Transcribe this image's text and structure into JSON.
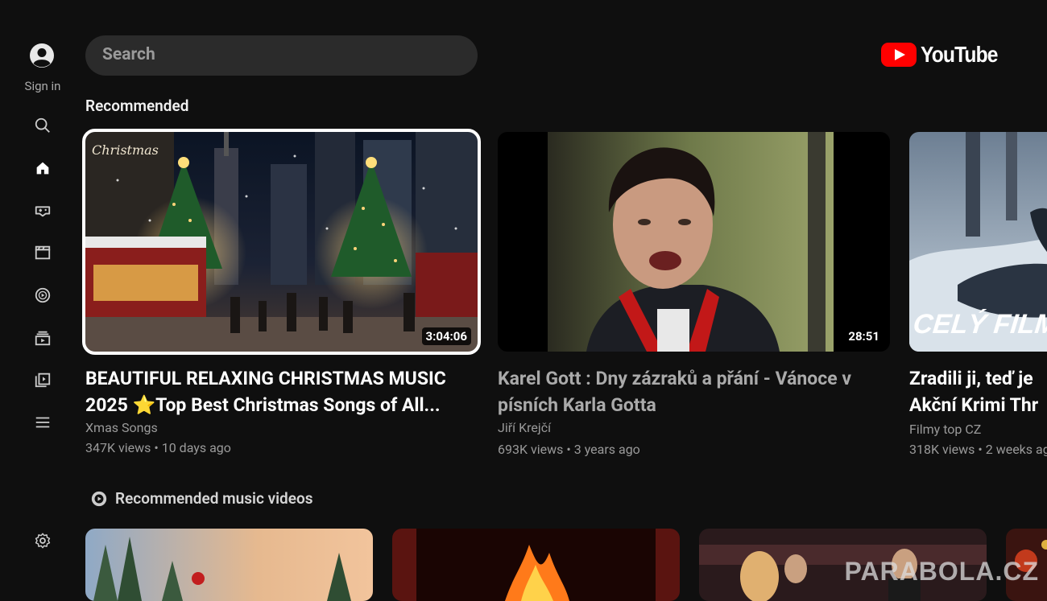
{
  "rail": {
    "sign_in_label": "Sign in",
    "items": [
      {
        "icon": "search-icon"
      },
      {
        "icon": "home-icon"
      },
      {
        "icon": "gaming-icon"
      },
      {
        "icon": "movies-icon"
      },
      {
        "icon": "music-icon"
      },
      {
        "icon": "subscriptions-icon"
      },
      {
        "icon": "library-icon"
      },
      {
        "icon": "menu-icon"
      },
      {
        "icon": "settings-icon"
      }
    ]
  },
  "search": {
    "placeholder": "Search"
  },
  "brand": {
    "name": "YouTube",
    "red": "#ff0000"
  },
  "recommended": {
    "heading": "Recommended",
    "videos": [
      {
        "title_line1": "BEAUTIFUL RELAXING CHRISTMAS MUSIC",
        "title_line2": "2025 ⭐Top Best Christmas Songs of All...",
        "channel": "Xmas Songs",
        "meta": "347K views • 10 days ago",
        "duration": "3:04:06",
        "thumb_caption": "Christmas"
      },
      {
        "title_line1": "Karel Gott : Dny zázraků a přání - Vánoce v",
        "title_line2": "písních Karla Gotta",
        "channel": "Jiří Krejčí",
        "meta": "693K views • 3 years ago",
        "duration": "28:51"
      },
      {
        "title_line1": "Zradili ji, teď je",
        "title_line2": "Akční Krimi Thr",
        "channel": "Filmy top CZ",
        "meta": "318K views • 2 weeks ag",
        "thumb_caption": "CELÝ FILM"
      }
    ]
  },
  "music_shelf": {
    "heading": "Recommended music videos"
  },
  "watermark": "PARABOLA.CZ"
}
